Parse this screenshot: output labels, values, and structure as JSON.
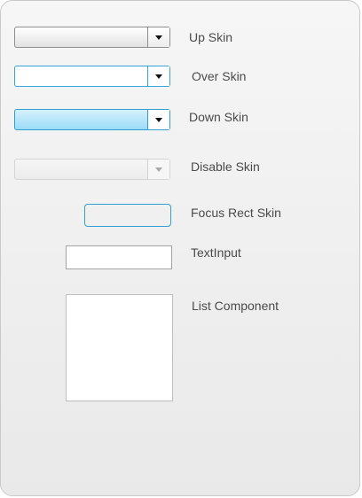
{
  "labels": {
    "up_skin": "Up Skin",
    "over_skin": "Over Skin",
    "down_skin": "Down Skin",
    "disable_skin": "Disable Skin",
    "focus_rect_skin": "Focus Rect Skin",
    "text_input": "TextInput",
    "list_component": "List Component"
  },
  "colors": {
    "focus_blue": "#2f9fd4",
    "down_fill": "#9bdcf7",
    "panel_bg": "#eeeeee",
    "label_text": "#4a4a4a"
  },
  "icons": {
    "dropdown_arrow": "chevron-down-icon"
  },
  "text_input": {
    "value": ""
  }
}
